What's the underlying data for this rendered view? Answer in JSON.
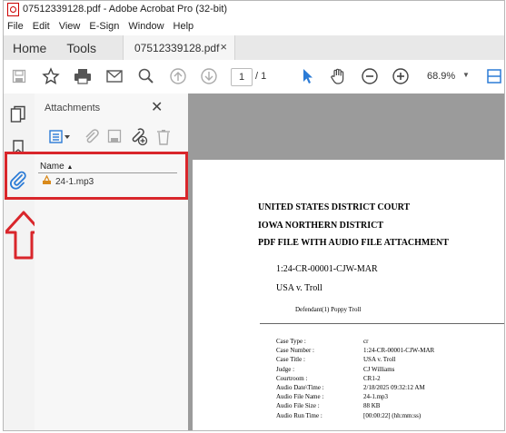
{
  "window": {
    "title": "07512339128.pdf - Adobe Acrobat Pro (32-bit)"
  },
  "menu": [
    "File",
    "Edit",
    "View",
    "E-Sign",
    "Window",
    "Help"
  ],
  "tabs": {
    "home": "Home",
    "tools": "Tools",
    "document": "07512339128.pdf",
    "close": "×"
  },
  "toolbar": {
    "page_current": "1",
    "page_total": "/ 1",
    "zoom": "68.9%"
  },
  "attachments": {
    "title": "Attachments",
    "close": "✕",
    "column_name": "Name",
    "files": [
      {
        "name": "24-1.mp3"
      }
    ]
  },
  "document": {
    "heading1": "UNITED STATES DISTRICT COURT",
    "heading2": "IOWA NORTHERN DISTRICT",
    "heading3": "PDF FILE WITH AUDIO FILE ATTACHMENT",
    "case_number": "1:24-CR-00001-CJW-MAR",
    "caption": "USA v. Troll",
    "defendant": "Defendant(1) Poppy Troll",
    "fields": [
      {
        "key": "Case Type :",
        "value": "cr"
      },
      {
        "key": "Case Number :",
        "value": "1:24-CR-00001-CJW-MAR"
      },
      {
        "key": "Case Title :",
        "value": "USA v. Troll"
      },
      {
        "key": "Judge :",
        "value": "CJ Williams"
      },
      {
        "key": "Courtroom :",
        "value": "CR1-2"
      },
      {
        "key": "Audio Date\\Time :",
        "value": "2/18/2025 09:32:12 AM"
      },
      {
        "key": "Audio File Name :",
        "value": "24-1.mp3"
      },
      {
        "key": "Audio File Size :",
        "value": "88 KB"
      },
      {
        "key": "Audio Run Time :",
        "value": "[00:00:22] (hh:mm:ss)"
      }
    ]
  },
  "colors": {
    "annotation_red": "#d9262b",
    "selection_blue": "#2b7bd6"
  }
}
